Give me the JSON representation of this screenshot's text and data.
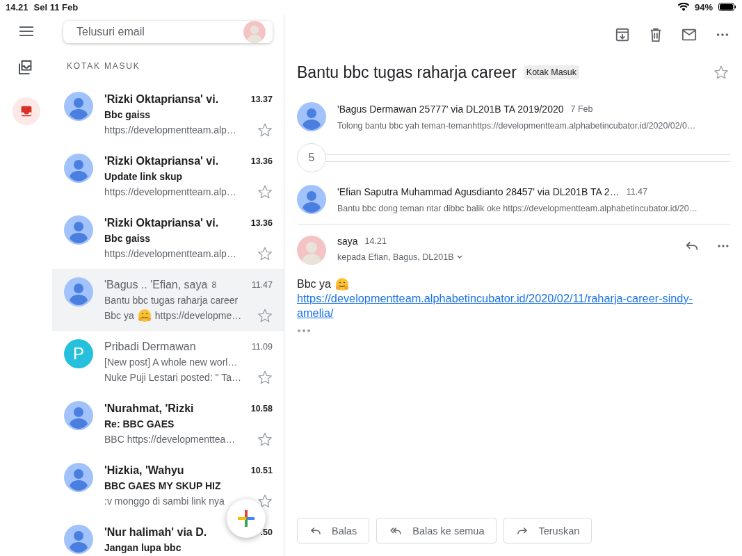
{
  "status_bar": {
    "time": "14.21",
    "date": "Sel 11 Feb",
    "battery": "94%"
  },
  "rail": {
    "items": [
      {
        "kind": "all-inboxes",
        "selected": false
      },
      {
        "kind": "inbox",
        "selected": true
      }
    ]
  },
  "search": {
    "placeholder": "Telusuri email"
  },
  "list": {
    "heading": "KOTAK MASUK",
    "rows": [
      {
        "sender": "'Rizki Oktapriansa' vi.",
        "time": "13.37",
        "subject": "Bbc gaiss",
        "snippet": [
          {
            "kind": "text",
            "text": "https://developmentteam.alp…"
          }
        ],
        "unread": true,
        "selected": false,
        "starred": false,
        "avatar": {
          "kind": "person"
        }
      },
      {
        "sender": "'Rizki Oktapriansa' vi.",
        "time": "13.36",
        "subject": "Update link skup",
        "snippet": [
          {
            "kind": "text",
            "text": "https://developmentteam.alp…"
          }
        ],
        "unread": true,
        "selected": false,
        "starred": false,
        "avatar": {
          "kind": "person"
        }
      },
      {
        "sender": "'Rizki Oktapriansa' vi.",
        "time": "13.36",
        "subject": "Bbc gaiss",
        "snippet": [
          {
            "kind": "text",
            "text": "https://developmentteam.alp…"
          }
        ],
        "unread": true,
        "selected": false,
        "starred": false,
        "avatar": {
          "kind": "person"
        }
      },
      {
        "sender": "'Bagus .. 'Efian, saya",
        "count": "8",
        "time": "11.47",
        "subject": "Bantu bbc tugas raharja career",
        "snippet": [
          {
            "kind": "text",
            "text": "Bbc ya"
          },
          {
            "kind": "emoji"
          },
          {
            "kind": "text",
            "text": "https://developme…"
          }
        ],
        "unread": false,
        "selected": true,
        "starred": false,
        "avatar": {
          "kind": "person"
        }
      },
      {
        "sender": "Pribadi Dermawan",
        "time": "11.09",
        "subject": "[New post] A whole new worl…",
        "snippet": [
          {
            "kind": "text",
            "text": "Nuke Puji Lestari posted: \" Ta…"
          }
        ],
        "unread": false,
        "selected": false,
        "starred": false,
        "avatar": {
          "kind": "letter",
          "letter": "P",
          "color": "#26c0dc"
        }
      },
      {
        "sender": "'Nurahmat, 'Rizki",
        "time": "10.58",
        "subject": "Re: BBC GAES",
        "snippet": [
          {
            "kind": "text",
            "text": "BBC https://developmenttea…"
          }
        ],
        "unread": true,
        "selected": false,
        "starred": false,
        "avatar": {
          "kind": "person"
        }
      },
      {
        "sender": "'Hizkia, 'Wahyu",
        "time": "10.51",
        "subject": "BBC GAES MY SKUP HIZ",
        "snippet": [
          {
            "kind": "text",
            "text": ":v monggo di sambi link nya"
          }
        ],
        "unread": true,
        "selected": false,
        "starred": false,
        "avatar": {
          "kind": "person"
        }
      },
      {
        "sender": "'Nur halimah' via D.",
        "time": ".50",
        "subject": "Jangan lupa bbc",
        "snippet": [],
        "unread": true,
        "selected": false,
        "avatar": {
          "kind": "person"
        }
      }
    ]
  },
  "conversation": {
    "subject": "Bantu bbc tugas raharja career",
    "label": "Kotak Masuk",
    "starred": false,
    "messages": [
      {
        "kind": "collapsed",
        "sender": "'Bagus Dermawan 25777' via DL201B TA 2019/2020",
        "time": "7 Feb",
        "snippet": "Tolong bantu bbc yah teman-temanhttps://developmentteam.alphabetincubator.id/2020/02/0…"
      },
      {
        "kind": "hidden",
        "count": "5"
      },
      {
        "kind": "collapsed",
        "sender": "'Efian Saputra Muhammad Agusdianto 28457' via DL201B TA 2…",
        "time": "11.47",
        "snippet": "Bantu bbc dong teman ntar dibbc balik oke https://developmentteam.alphabetincubator.id/20…"
      },
      {
        "kind": "expanded",
        "sender": "saya",
        "time": "14.21",
        "recipients": "kepada Efian, Bagus, DL201B",
        "body": [
          {
            "kind": "text",
            "text": "Bbc ya"
          },
          {
            "kind": "emoji"
          }
        ],
        "link": "https://developmentteam.alphabetincubator.id/2020/02/11/raharja-career-sindy-amelia/"
      }
    ]
  },
  "buttons": [
    {
      "kind": "reply",
      "label": "Balas"
    },
    {
      "kind": "reply-all",
      "label": "Balas ke semua"
    },
    {
      "kind": "forward",
      "label": "Teruskan"
    }
  ]
}
